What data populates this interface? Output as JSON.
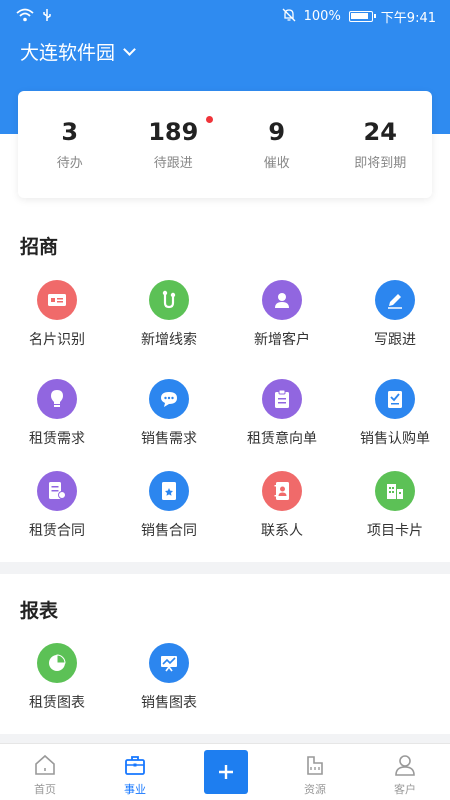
{
  "status_bar": {
    "battery": "100%",
    "time": "下午9:41"
  },
  "park_name": "大连软件园",
  "stats": [
    {
      "value": "3",
      "label": "待办"
    },
    {
      "value": "189",
      "label": "待跟进"
    },
    {
      "value": "9",
      "label": "催收"
    },
    {
      "value": "24",
      "label": "即将到期"
    }
  ],
  "sections": {
    "invest": {
      "title": "招商",
      "items": [
        {
          "label": "名片识别",
          "icon": "business-card-icon",
          "color": "#f06a6a"
        },
        {
          "label": "新增线索",
          "icon": "clue-icon",
          "color": "#5cc156"
        },
        {
          "label": "新增客户",
          "icon": "add-customer-icon",
          "color": "#9166e0"
        },
        {
          "label": "写跟进",
          "icon": "pencil-icon",
          "color": "#2c86ef"
        },
        {
          "label": "租赁需求",
          "icon": "bulb-icon",
          "color": "#9166e0"
        },
        {
          "label": "销售需求",
          "icon": "chat-icon",
          "color": "#2c86ef"
        },
        {
          "label": "租赁意向单",
          "icon": "clipboard-icon",
          "color": "#9166e0"
        },
        {
          "label": "销售认购单",
          "icon": "checklist-icon",
          "color": "#2c86ef"
        },
        {
          "label": "租赁合同",
          "icon": "lease-contract-icon",
          "color": "#9166e0"
        },
        {
          "label": "销售合同",
          "icon": "sales-contract-icon",
          "color": "#2c86ef"
        },
        {
          "label": "联系人",
          "icon": "contacts-icon",
          "color": "#f06a6a"
        },
        {
          "label": "项目卡片",
          "icon": "building-card-icon",
          "color": "#5cc156"
        }
      ]
    },
    "reports": {
      "title": "报表",
      "items": [
        {
          "label": "租赁图表",
          "icon": "pie-chart-icon",
          "color": "#5cc156"
        },
        {
          "label": "销售图表",
          "icon": "line-chart-icon",
          "color": "#2c86ef"
        }
      ]
    }
  },
  "bottom_nav": [
    {
      "label": "首页",
      "icon": "home-icon",
      "active": false
    },
    {
      "label": "事业",
      "icon": "briefcase-icon",
      "active": true
    },
    {
      "label": "",
      "icon": "plus-icon",
      "active": false
    },
    {
      "label": "资源",
      "icon": "resource-icon",
      "active": false
    },
    {
      "label": "客户",
      "icon": "customer-icon",
      "active": false
    }
  ]
}
